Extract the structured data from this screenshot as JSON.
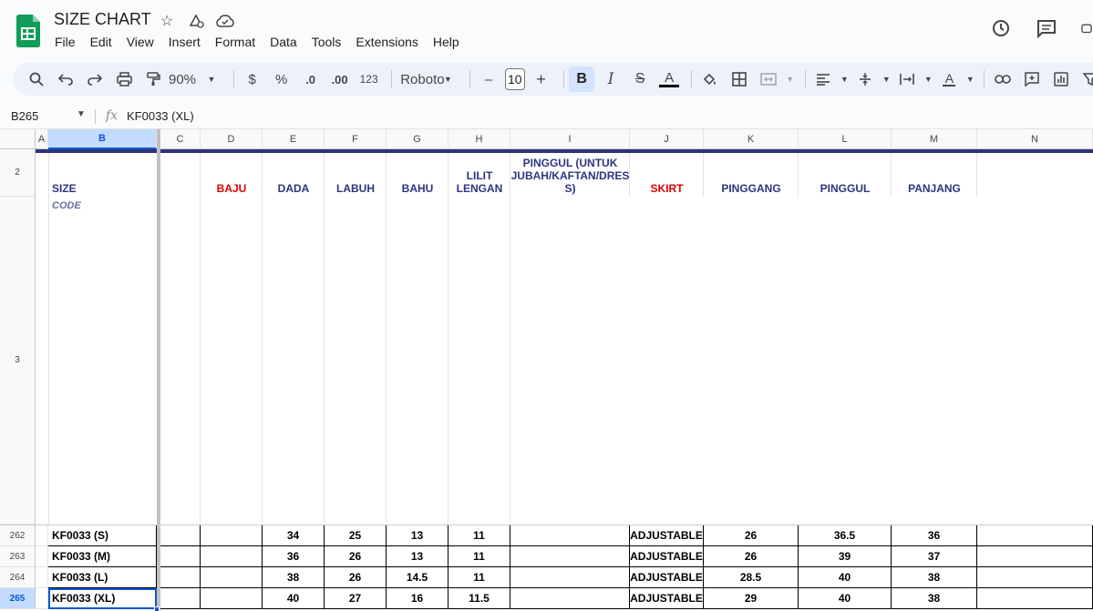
{
  "doc": {
    "title": "SIZE CHART"
  },
  "menu": [
    "File",
    "Edit",
    "View",
    "Insert",
    "Format",
    "Data",
    "Tools",
    "Extensions",
    "Help"
  ],
  "toolbar": {
    "zoom": "90%",
    "currency": "$",
    "percent": "%",
    "dec_decrease": ".0",
    "dec_increase": ".00",
    "number_format": "123",
    "font": "Roboto",
    "font_size": "10",
    "minus": "–",
    "plus": "+"
  },
  "formula_bar": {
    "cell_ref": "B265",
    "fx": "fx",
    "value": "KF0033 (XL)"
  },
  "columns": [
    "A",
    "B",
    "C",
    "D",
    "E",
    "F",
    "G",
    "H",
    "I",
    "J",
    "K",
    "L",
    "M",
    "N"
  ],
  "header_rows": {
    "row2": "2",
    "row3": "3"
  },
  "headers": {
    "size": "SIZE",
    "code": "CODE",
    "baju": "BAJU",
    "dada": "DADA",
    "labuh": "LABUH",
    "bahu": "BAHU",
    "lilit_lengan_1": "LILIT",
    "lilit_lengan_2": "LENGAN",
    "pinggul_long_1": "PINGGUL (UNTUK",
    "pinggul_long_2": "JUBAH/KAFTAN/DRES",
    "pinggul_long_3": "S)",
    "skirt": "SKIRT",
    "pinggang": "PINGGANG",
    "pinggul": "PINGGUL",
    "panjang": "PANJANG"
  },
  "rows": [
    {
      "num": "262",
      "code": "KF0033 (S)",
      "dada": "34",
      "labuh": "25",
      "bahu": "13",
      "lengan": "11",
      "skirt": "ADJUSTABLE",
      "pinggang": "26",
      "pinggul": "36.5",
      "panjang": "36"
    },
    {
      "num": "263",
      "code": "KF0033 (M)",
      "dada": "36",
      "labuh": "26",
      "bahu": "13",
      "lengan": "11",
      "skirt": "ADJUSTABLE",
      "pinggang": "26",
      "pinggul": "39",
      "panjang": "37"
    },
    {
      "num": "264",
      "code": "KF0033 (L)",
      "dada": "38",
      "labuh": "26",
      "bahu": "14.5",
      "lengan": "11",
      "skirt": "ADJUSTABLE",
      "pinggang": "28.5",
      "pinggul": "40",
      "panjang": "38"
    },
    {
      "num": "265",
      "code": "KF0033 (XL)",
      "dada": "40",
      "labuh": "27",
      "bahu": "16",
      "lengan": "11.5",
      "skirt": "ADJUSTABLE",
      "pinggang": "29",
      "pinggul": "40",
      "panjang": "38"
    }
  ],
  "colors": {
    "header_blue": "#2e3480",
    "header_red": "#e00000",
    "selection": "#0b57d0"
  }
}
